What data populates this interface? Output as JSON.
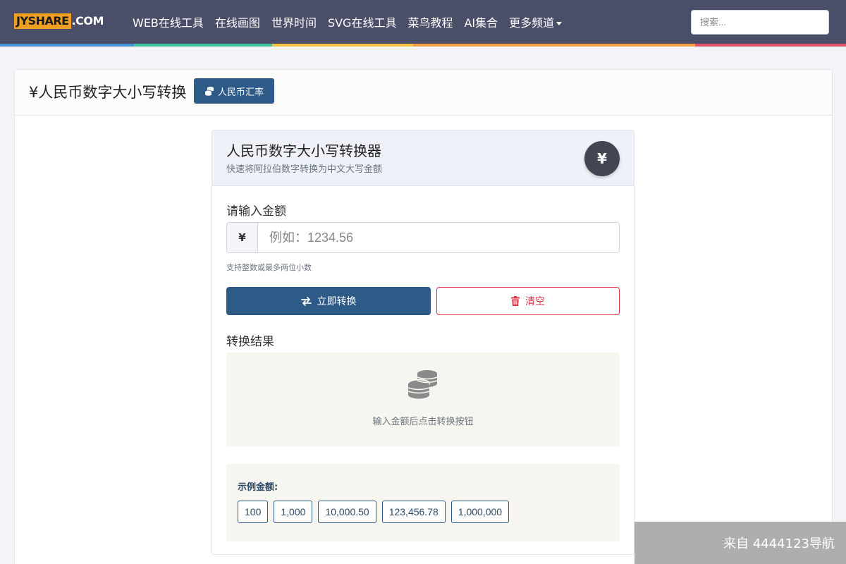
{
  "navbar": {
    "logo_part1": "JYSHARE",
    "logo_part2": ".COM",
    "links": [
      {
        "label": "WEB在线工具"
      },
      {
        "label": "在线画图"
      },
      {
        "label": "世界时间"
      },
      {
        "label": "SVG在线工具"
      },
      {
        "label": "菜鸟教程"
      },
      {
        "label": "AI集合"
      },
      {
        "label": "更多频道"
      }
    ],
    "search_placeholder": "搜索...",
    "rainbow_colors": [
      "#4a90d9",
      "#3cc5a0",
      "#f5c542",
      "#f0a048",
      "#e0506a"
    ]
  },
  "page_header": {
    "title": "¥人民币数字大小写转换",
    "rate_button": "人民币汇率"
  },
  "converter": {
    "title": "人民币数字大小写转换器",
    "subtitle": "快速将阿拉伯数字转换为中文大写金额",
    "currency_symbol": "¥",
    "amount_label": "请输入金额",
    "input_prefix": "¥",
    "input_placeholder": "例如：1234.56",
    "input_value": "",
    "hint": "支持整数或最多两位小数",
    "convert_button": "立即转换",
    "clear_button": "清空",
    "result_label": "转换结果",
    "result_placeholder": "输入金额后点击转换按钮",
    "examples_label": "示例金额:",
    "examples": [
      "100",
      "1,000",
      "10,000.50",
      "123,456.78",
      "1,000,000"
    ]
  },
  "watermark": "来自 4444123导航",
  "colors": {
    "navbar_bg": "#4a4e69",
    "primary": "#2e5a88",
    "danger": "#dc3545",
    "logo_accent": "#f0a020"
  }
}
